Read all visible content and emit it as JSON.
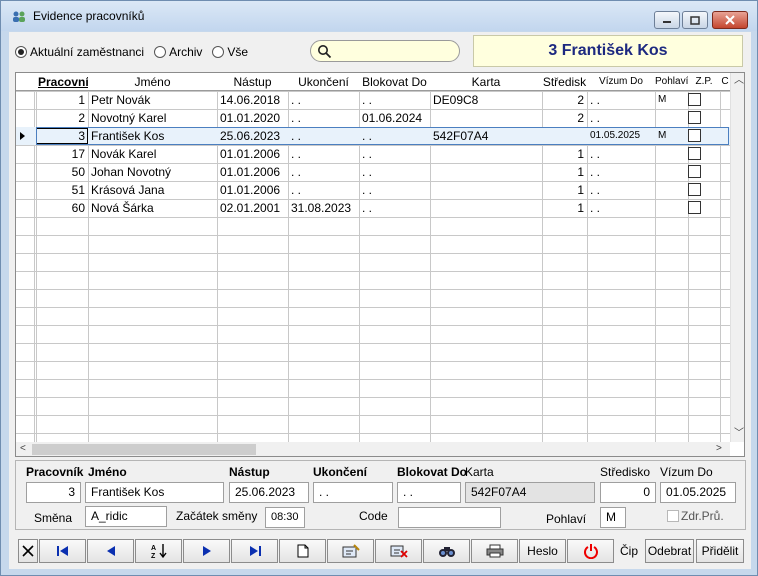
{
  "window": {
    "title": "Evidence pracovníků"
  },
  "filter": {
    "options": [
      {
        "label": "Aktuální zaměstnanci",
        "selected": true
      },
      {
        "label": "Archiv",
        "selected": false
      },
      {
        "label": "Vše",
        "selected": false
      }
    ]
  },
  "search": {
    "value": "",
    "placeholder": ""
  },
  "selected_header": "3 František Kos",
  "grid": {
    "columns": [
      "Pracovník",
      "Jméno",
      "Nástup",
      "Ukončení",
      "Blokovat Do",
      "Karta",
      "Středisk",
      "Vízum Do",
      "Pohlaví",
      "Z.P.",
      "C"
    ],
    "rows": [
      {
        "id": "1",
        "name": "Petr Novák",
        "start": "14.06.2018",
        "end": ". .",
        "block": ". .",
        "card": "DE09C8",
        "center": "2",
        "visa": ". .",
        "gender": "M"
      },
      {
        "id": "2",
        "name": "Novotný Karel",
        "start": "01.01.2020",
        "end": ". .",
        "block": "01.06.2024",
        "card": "",
        "center": "2",
        "visa": ". .",
        "gender": ""
      },
      {
        "id": "3",
        "name": "František Kos",
        "start": "25.06.2023",
        "end": ". .",
        "block": ". .",
        "card": "542F07A4",
        "center": "",
        "visa": "01.05.2025",
        "gender": "M"
      },
      {
        "id": "17",
        "name": "Novák Karel",
        "start": "01.01.2006",
        "end": ". .",
        "block": ". .",
        "card": "",
        "center": "1",
        "visa": ". .",
        "gender": ""
      },
      {
        "id": "50",
        "name": "Johan Novotný",
        "start": "01.01.2006",
        "end": ". .",
        "block": ". .",
        "card": "",
        "center": "1",
        "visa": ". .",
        "gender": ""
      },
      {
        "id": "51",
        "name": "Krásová Jana",
        "start": "01.01.2006",
        "end": ". .",
        "block": ". .",
        "card": "",
        "center": "1",
        "visa": ". .",
        "gender": ""
      },
      {
        "id": "60",
        "name": "Nová Šárka",
        "start": "02.01.2001",
        "end": "31.08.2023",
        "block": ". .",
        "card": "",
        "center": "1",
        "visa": ". .",
        "gender": ""
      }
    ]
  },
  "detail": {
    "labels": {
      "worker": "Pracovník",
      "name": "Jméno",
      "start": "Nástup",
      "end": "Ukončení",
      "block": "Blokovat Do",
      "card": "Karta",
      "center": "Středisko",
      "visa": "Vízum Do",
      "shift": "Směna",
      "shift_start": "Začátek směny",
      "code": "Code",
      "gender": "Pohlaví",
      "health": "Zdr.Prů."
    },
    "values": {
      "worker": "3",
      "name": "František Kos",
      "start": "25.06.2023",
      "end": ". .",
      "block": ". .",
      "card": "542F07A4",
      "center": "0",
      "visa": "01.05.2025",
      "shift": "A_ridic",
      "shift_start": "08:30",
      "code": "",
      "gender": "M"
    }
  },
  "toolbar": {
    "heslo": "Heslo",
    "cip": "Čip",
    "odebrat": "Odebrat",
    "pridelit": "Přidělit"
  }
}
